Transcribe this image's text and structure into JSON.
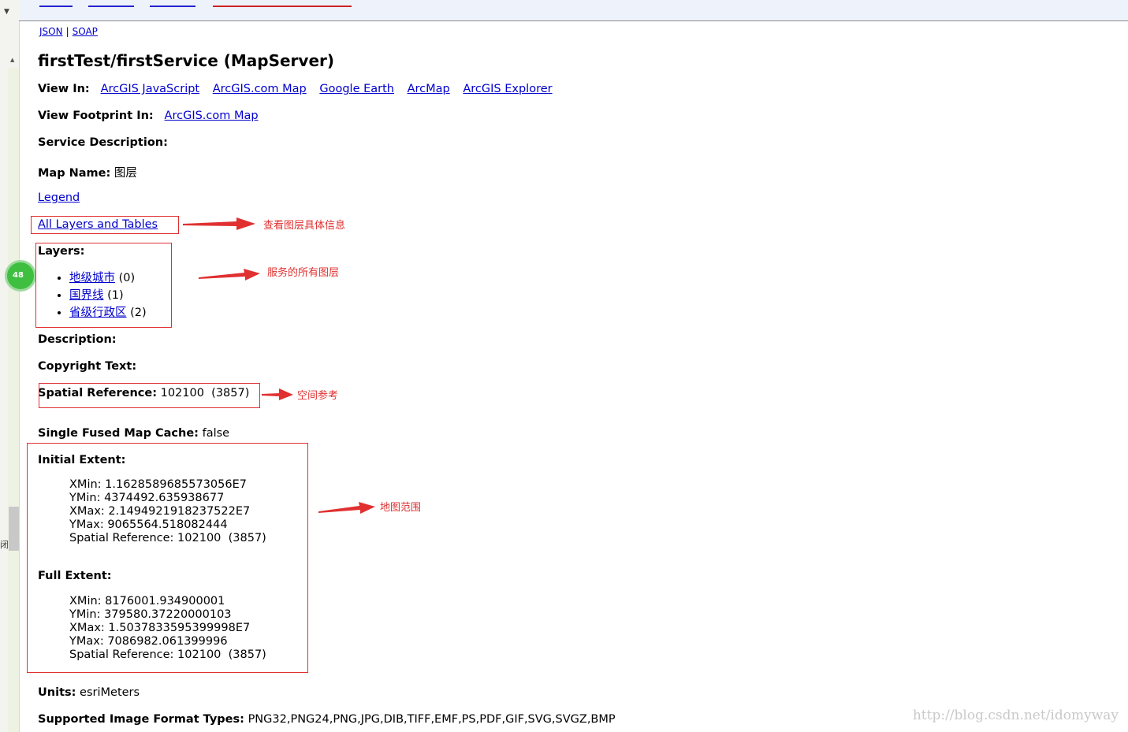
{
  "formats": {
    "json": "JSON",
    "soap": "SOAP",
    "sep": "|"
  },
  "title": "firstTest/firstService (MapServer)",
  "view_in": {
    "label": "View In:",
    "links": [
      "ArcGIS JavaScript",
      "ArcGIS.com Map",
      "Google Earth",
      "ArcMap",
      "ArcGIS Explorer"
    ]
  },
  "view_footprint": {
    "label": "View Footprint In:",
    "link": "ArcGIS.com Map"
  },
  "service_description": {
    "label": "Service Description:"
  },
  "map_name": {
    "label": "Map Name:",
    "value": "图层"
  },
  "legend_link": "Legend",
  "all_layers_link": "All Layers and Tables",
  "layers": {
    "label": "Layers:",
    "items": [
      {
        "name": "地级城市",
        "id": "(0)"
      },
      {
        "name": "国界线",
        "id": "(1)"
      },
      {
        "name": "省级行政区",
        "id": "(2)"
      }
    ]
  },
  "description": {
    "label": "Description:"
  },
  "copyright": {
    "label": "Copyright Text:"
  },
  "spatial_reference": {
    "label": "Spatial Reference:",
    "value": "102100  (3857)"
  },
  "single_fused_cache": {
    "label": "Single Fused Map Cache:",
    "value": "false"
  },
  "initial_extent": {
    "label": "Initial Extent:",
    "xmin": "XMin: 1.1628589685573056E7",
    "ymin": "YMin: 4374492.635938677",
    "xmax": "XMax: 2.1494921918237522E7",
    "ymax": "YMax: 9065564.518082444",
    "sr": "Spatial Reference: 102100  (3857)"
  },
  "full_extent": {
    "label": "Full Extent:",
    "xmin": "XMin: 8176001.934900001",
    "ymin": "YMin: 379580.37220000103",
    "xmax": "XMax: 1.5037833595399998E7",
    "ymax": "YMax: 7086982.061399996",
    "sr": "Spatial Reference: 102100  (3857)"
  },
  "units": {
    "label": "Units:",
    "value": "esriMeters"
  },
  "image_formats": {
    "label": "Supported Image Format Types:",
    "value": "PNG32,PNG24,PNG,JPG,DIB,TIFF,EMF,PS,PDF,GIF,SVG,SVGZ,BMP"
  },
  "annotations": {
    "all_layers": "查看图层具体信息",
    "layers": "服务的所有图层",
    "spatial_ref": "空间参考",
    "extent": "地图范围"
  },
  "gutter": {
    "badge": "48",
    "char": "闭"
  },
  "watermark": "http://blog.csdn.net/idomyway",
  "colors": {
    "link": "#0000cc",
    "annotation": "#e03030",
    "badge": "#3fbf3f"
  }
}
